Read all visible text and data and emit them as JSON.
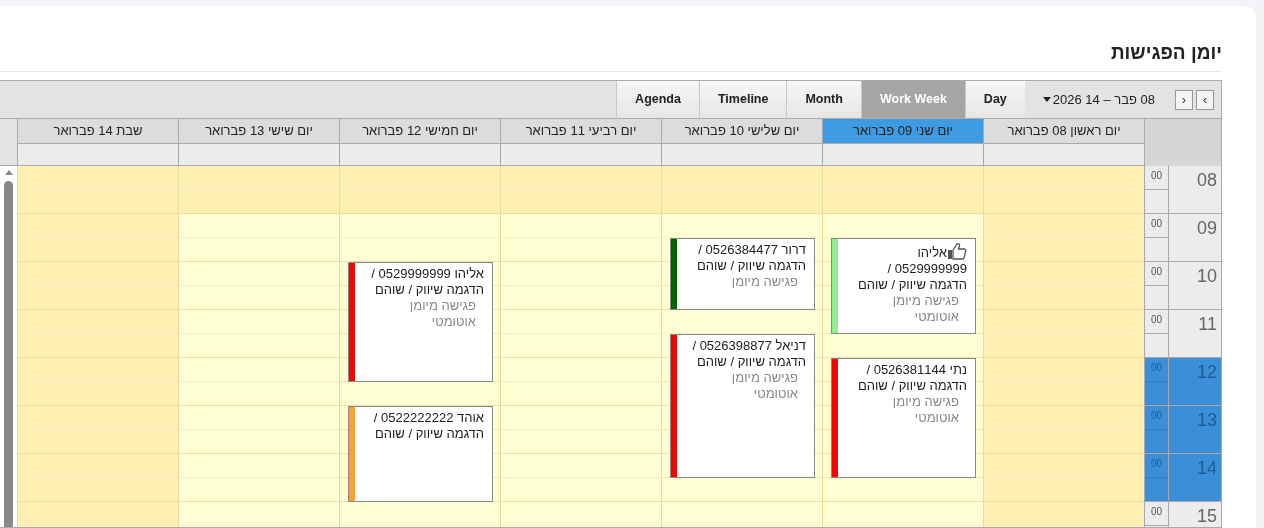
{
  "page": {
    "title": "יומן הפגישות"
  },
  "toolbar": {
    "nav_buttons": [
      {
        "label": "‹"
      },
      {
        "label": "›"
      }
    ],
    "date_range": "08 פבר – 14 2026",
    "views": [
      {
        "label": "Day",
        "selected": false
      },
      {
        "label": "Work Week",
        "selected": true
      },
      {
        "label": "Month",
        "selected": false
      },
      {
        "label": "Timeline",
        "selected": false
      },
      {
        "label": "Agenda",
        "selected": false
      }
    ]
  },
  "days": [
    {
      "label": "יום ראשון 08 פברואר",
      "selected": false,
      "workday": false
    },
    {
      "label": "יום שני 09 פברואר",
      "selected": true,
      "workday": true,
      "slots": [
        {
          "kind": "free"
        },
        {
          "kind": "free"
        },
        {
          "kind": "free"
        },
        {
          "kind": "appointment",
          "title": "אליהו 0529999999 / הדגמה שיווק / שוהם",
          "note": "פגישה מיומן אוטומטי",
          "color": "#90ee90",
          "liked": true
        },
        {
          "kind": "busy"
        },
        {
          "kind": "busy"
        },
        {
          "kind": "busy"
        },
        {
          "kind": "free"
        },
        {
          "kind": "appointment",
          "title": "נתי 0526381144 / הדגמה שיווק / שוהם",
          "note": "פגישה מיומן אוטומטי",
          "color": "#ff0000",
          "liked": false
        },
        {
          "kind": "busy"
        },
        {
          "kind": "busy"
        },
        {
          "kind": "busy"
        },
        {
          "kind": "busy"
        },
        {
          "kind": "free"
        },
        {
          "kind": "free"
        },
        {
          "kind": "free"
        }
      ]
    },
    {
      "label": "יום שלישי 10 פברואר",
      "selected": false,
      "workday": true,
      "slots": [
        {
          "kind": "free"
        },
        {
          "kind": "free"
        },
        {
          "kind": "free"
        },
        {
          "kind": "appointment",
          "title": "דרור 0526384477 / הדגמה שיווק / שוהם",
          "note": "פגישה מיומן",
          "color": "#006400",
          "liked": false
        },
        {
          "kind": "busy"
        },
        {
          "kind": "busy"
        },
        {
          "kind": "free"
        },
        {
          "kind": "appointment",
          "title": "דניאל 0526398877 / הדגמה שיווק / שוהם",
          "note": "פגישה מיומן אוטומטי",
          "color": "#ff0000",
          "liked": false
        },
        {
          "kind": "busy"
        },
        {
          "kind": "busy"
        },
        {
          "kind": "busy"
        },
        {
          "kind": "busy"
        },
        {
          "kind": "busy"
        },
        {
          "kind": "free"
        },
        {
          "kind": "free"
        },
        {
          "kind": "free"
        }
      ]
    },
    {
      "label": "יום רביעי 11 פברואר",
      "selected": false,
      "workday": true
    },
    {
      "label": "יום חמישי 12 פברואר",
      "selected": false,
      "workday": true,
      "slots": [
        {
          "kind": "free"
        },
        {
          "kind": "free"
        },
        {
          "kind": "free"
        },
        {
          "kind": "free"
        },
        {
          "kind": "appointment",
          "title": "אליהו 0529999999 / הדגמה שיווק / שוהם",
          "note": "פגישה מיומן אוטומטי",
          "color": "#ff0000",
          "liked": false
        },
        {
          "kind": "busy"
        },
        {
          "kind": "busy"
        },
        {
          "kind": "busy"
        },
        {
          "kind": "busy"
        },
        {
          "kind": "free"
        },
        {
          "kind": "appointment",
          "title": "אוהד 0522222222 / הדגמה שיווק / שוהם",
          "color": "#f7a035",
          "liked": false
        },
        {
          "kind": "busy"
        },
        {
          "kind": "busy"
        },
        {
          "kind": "busy"
        },
        {
          "kind": "free"
        },
        {
          "kind": "free"
        }
      ]
    },
    {
      "label": "יום שישי 13 פברואר",
      "selected": false,
      "workday": true
    },
    {
      "label": "שבת 14 פברואר",
      "selected": false,
      "workday": false
    }
  ],
  "hours": [
    {
      "hour": "08",
      "minutes": "00",
      "work": false,
      "selected": false
    },
    {
      "hour": "09",
      "minutes": "00",
      "work": true,
      "selected": false
    },
    {
      "hour": "10",
      "minutes": "00",
      "work": true,
      "selected": false
    },
    {
      "hour": "11",
      "minutes": "00",
      "work": true,
      "selected": false
    },
    {
      "hour": "12",
      "minutes": "00",
      "work": true,
      "selected": true
    },
    {
      "hour": "13",
      "minutes": "00",
      "work": true,
      "selected": true
    },
    {
      "hour": "14",
      "minutes": "00",
      "work": true,
      "selected": true
    },
    {
      "hour": "15",
      "minutes": "00",
      "work": true,
      "selected": false
    }
  ]
}
